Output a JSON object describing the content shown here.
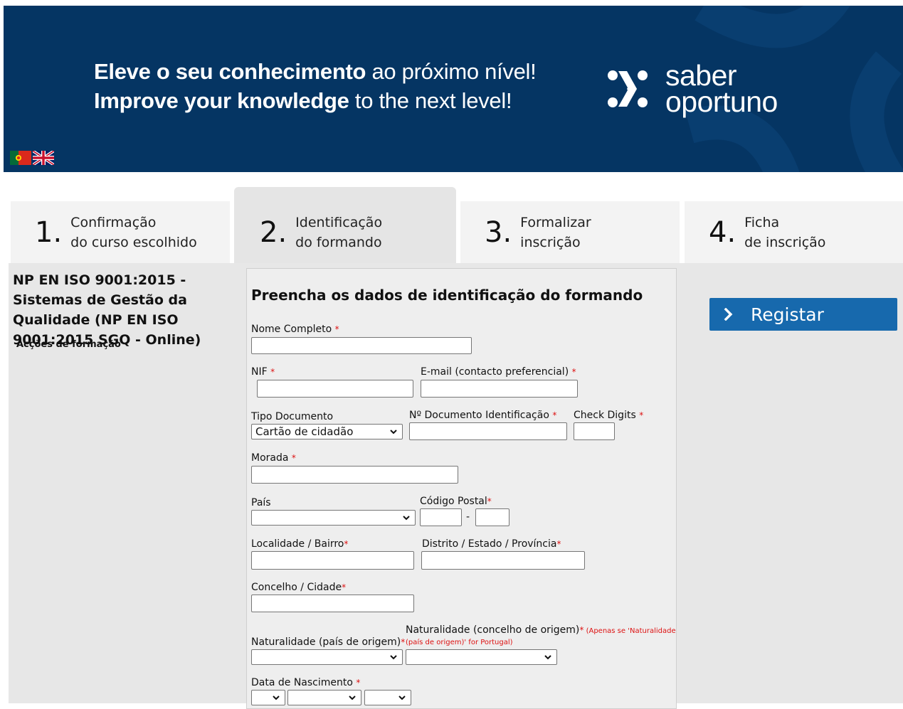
{
  "banner": {
    "line1_bold": "Eleve o seu conhecimento",
    "line1_rest": " ao próximo nível!",
    "line2_bold": "Improve your knowledge",
    "line2_rest": " to the next level!",
    "logo_line1": "saber",
    "logo_line2": "oportuno",
    "colors": {
      "background": "#053563",
      "text": "#ffffff"
    }
  },
  "languages": [
    {
      "name": "portugal-flag-icon"
    },
    {
      "name": "uk-flag-icon"
    }
  ],
  "steps": [
    {
      "num": "1.",
      "line1": "Confirmação",
      "line2": "do curso escolhido",
      "active": false
    },
    {
      "num": "2.",
      "line1": "Identificação",
      "line2": "do formando",
      "active": true
    },
    {
      "num": "3.",
      "line1": "Formalizar",
      "line2": "inscrição",
      "active": false
    },
    {
      "num": "4.",
      "line1": "Ficha",
      "line2": "de inscrição",
      "active": false
    }
  ],
  "sidebar": {
    "course_title": "NP EN ISO 9001:2015 - Sistemas de Gestão da Qualidade (NP EN ISO 9001:2015 SGQ - Online)",
    "actions_label": "Acções de formação"
  },
  "form": {
    "title": "Preencha os dados de identificação do formando",
    "required_mark": "*",
    "nome_label": "Nome Completo",
    "nif_label": "NIF",
    "email_label": "E-mail (contacto preferencial)",
    "tipo_doc_label": "Tipo Documento",
    "tipo_doc_value": "Cartão de cidadão",
    "num_doc_label": "Nº Documento Identificação",
    "check_digits_label": "Check Digits",
    "morada_label": "Morada",
    "pais_label": "País",
    "pais_value": "",
    "codigo_postal_label": "Código Postal",
    "codigo_postal_sep": "-",
    "localidade_label": "Localidade / Bairro",
    "distrito_label": "Distrito / Estado / Província",
    "concelho_label": "Concelho / Cidade",
    "naturalidade_pais_label": "Naturalidade (país de origem)",
    "naturalidade_concelho_label": "Naturalidade (concelho de origem)",
    "naturalidade_note_1": " (Apenas se 'Naturalidade",
    "naturalidade_note_2": "(país de origem)' for Portugal)",
    "data_nascimento_label": "Data de Nascimento"
  },
  "register_button": {
    "label": "Registar",
    "color": "#1769ad"
  }
}
